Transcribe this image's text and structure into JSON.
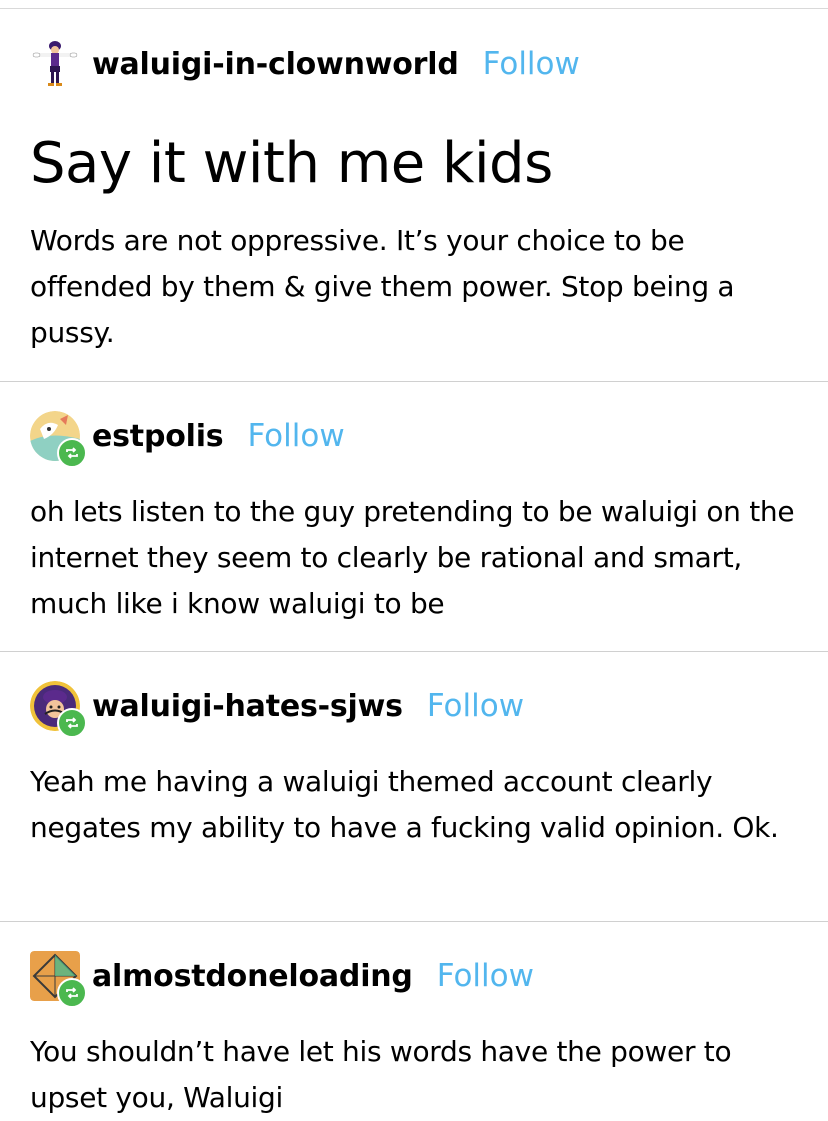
{
  "follow_label": "Follow",
  "colors": {
    "follow": "#52b6ee",
    "reblog_badge": "#4bb84f",
    "divider": "#d0d0d0"
  },
  "posts": [
    {
      "username": "waluigi-in-clownworld",
      "avatar_icon": "waluigi-tpose-icon",
      "title": "Say it with me kids",
      "body": "Words are not oppressive. It’s your choice to be offended by them & give them power. Stop being a pussy."
    },
    {
      "username": "estpolis",
      "avatar_icon": "estpolis-avatar",
      "reblog_icon": "reblog-icon",
      "body": "oh lets listen to the guy pretending to be waluigi on the internet they seem to clearly be rational and smart, much like i know waluigi to be"
    },
    {
      "username": "waluigi-hates-sjws",
      "avatar_icon": "waluigi-avatar",
      "reblog_icon": "reblog-icon",
      "body": "Yeah me having a waluigi themed account clearly negates my ability to have a fucking valid opinion. Ok."
    },
    {
      "username": "almostdoneloading",
      "avatar_icon": "almostdoneloading-avatar",
      "reblog_icon": "reblog-icon",
      "body": "You shouldn’t have let his words have the power to upset you, Waluigi"
    }
  ]
}
